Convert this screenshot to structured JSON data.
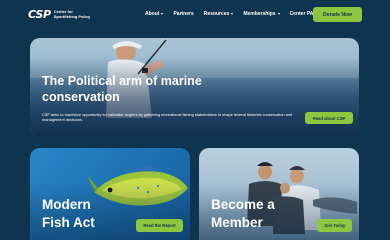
{
  "header": {
    "logo_mark": "CSP",
    "logo_line1": "Center for",
    "logo_line2": "Sportfishing Policy",
    "nav": [
      {
        "label": "About",
        "dropdown": true
      },
      {
        "label": "Partners",
        "dropdown": false
      },
      {
        "label": "Resources",
        "dropdown": true
      },
      {
        "label": "Memberships",
        "dropdown": true
      },
      {
        "label": "Center PAC",
        "dropdown": false
      }
    ],
    "donate_label": "Donate Now"
  },
  "hero": {
    "title": "The Political arm of marine conservation",
    "subtitle": "CSP aims to maximize opportunity for saltwater anglers by gathering recreational fishing stakeholders to shape federal fisheries conservation and management decisions.",
    "button_label": "Read about CSP"
  },
  "cards": [
    {
      "title_line1": "Modern",
      "title_line2": "Fish Act",
      "button_label": "Read the Report"
    },
    {
      "title_line1": "Become a",
      "title_line2": "Member",
      "button_label": "Join Today"
    }
  ],
  "colors": {
    "navy": "#0e3450",
    "accent_green": "#8dc63f",
    "card_blue": "#1c6fb0"
  }
}
